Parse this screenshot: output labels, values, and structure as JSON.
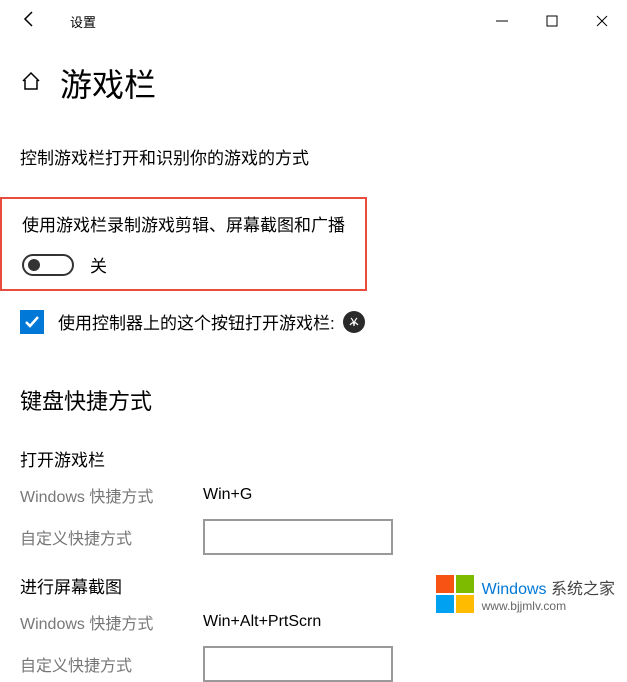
{
  "titlebar": {
    "app_title": "设置"
  },
  "page": {
    "title": "游戏栏",
    "description": "控制游戏栏打开和识别你的游戏的方式"
  },
  "main_toggle": {
    "label": "使用游戏栏录制游戏剪辑、屏幕截图和广播",
    "state": "关"
  },
  "controller_checkbox": {
    "label": "使用控制器上的这个按钮打开游戏栏:"
  },
  "shortcuts": {
    "section_title": "键盘快捷方式",
    "groups": [
      {
        "title": "打开游戏栏",
        "predefined_label": "Windows 快捷方式",
        "predefined_value": "Win+G",
        "custom_label": "自定义快捷方式"
      },
      {
        "title": "进行屏幕截图",
        "predefined_label": "Windows 快捷方式",
        "predefined_value": "Win+Alt+PrtScrn",
        "custom_label": "自定义快捷方式"
      }
    ]
  },
  "watermark": {
    "brand": "Windows",
    "tagline": "系统之家",
    "url": "www.bjjmlv.com",
    "colors": {
      "tl": "#f65314",
      "tr": "#7cbb00",
      "bl": "#00a1f1",
      "br": "#ffbb00"
    }
  }
}
